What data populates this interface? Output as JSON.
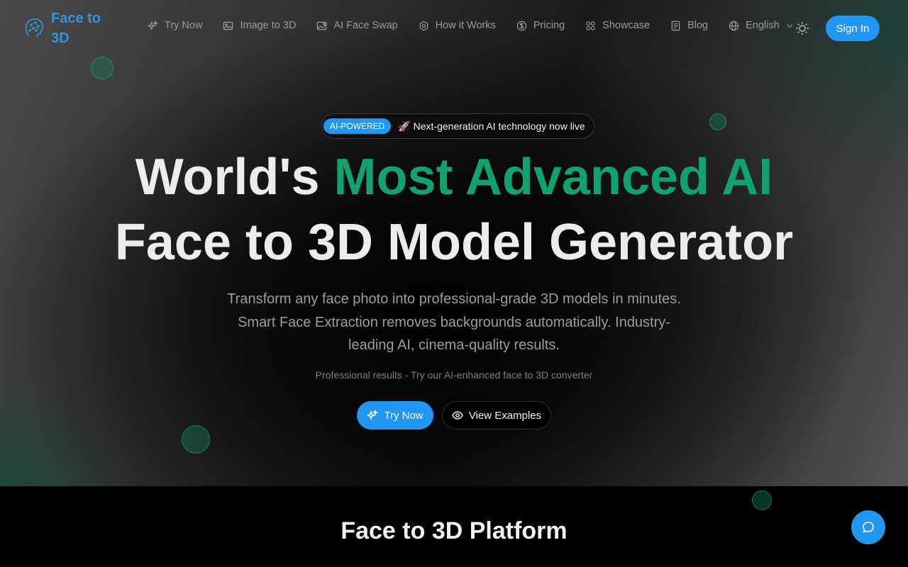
{
  "brand": {
    "name": "Face to 3D"
  },
  "nav": {
    "items": [
      {
        "label": "Try Now",
        "icon": "sparkles-icon"
      },
      {
        "label": "Image to 3D",
        "icon": "image-icon"
      },
      {
        "label": "AI Face Swap",
        "icon": "image-edit-icon"
      },
      {
        "label": "How it Works",
        "icon": "gear-icon"
      },
      {
        "label": "Pricing",
        "icon": "dollar-circle-icon"
      },
      {
        "label": "Showcase",
        "icon": "grid-icon"
      },
      {
        "label": "Blog",
        "icon": "document-icon"
      }
    ],
    "language": "English",
    "sign_in": "Sign In"
  },
  "hero": {
    "badge_pill": "AI-POWERED",
    "badge_text": "🚀 Next-generation AI technology now live",
    "title_prefix": "World's ",
    "title_accent": "Most Advanced AI",
    "title_line2": "Face to 3D Model Generator",
    "subtitle": "Transform any face photo into professional-grade 3D models in minutes. Smart Face Extraction removes backgrounds automatically. Industry-leading AI, cinema-quality results.",
    "note": "Professional results - Try our AI-enhanced face to 3D converter",
    "cta_primary": "Try Now",
    "cta_secondary": "View Examples"
  },
  "platform": {
    "heading": "Face to 3D Platform"
  },
  "colors": {
    "accent_blue": "#2196f3",
    "accent_green": "#11a36f",
    "brand_blue": "#2f96e6"
  }
}
